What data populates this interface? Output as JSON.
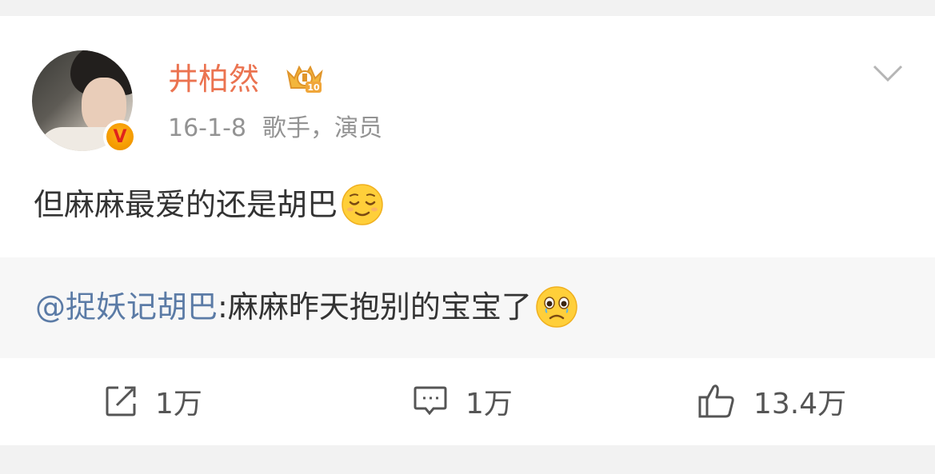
{
  "post": {
    "username": "井柏然",
    "date": "16-1-8",
    "source": "歌手，演员",
    "text": "但麻麻最爱的还是胡巴",
    "text_emoji": "relieved-face-icon",
    "verified_icon": "v-verified-icon",
    "level_icon": "crown-level-10-icon",
    "level_badge_text": "10"
  },
  "repost": {
    "mention": "@捉妖记胡巴",
    "text": ":麻麻昨天抱别的宝宝了",
    "emoji": "crying-face-icon"
  },
  "actions": {
    "repost": {
      "icon": "edit-share-icon",
      "count": "1万"
    },
    "comment": {
      "icon": "comment-icon",
      "count": "1万"
    },
    "like": {
      "icon": "thumbs-up-icon",
      "count": "13.4万"
    }
  },
  "colors": {
    "username": "#eb7350",
    "mention": "#5b7ba6",
    "meta": "#939393",
    "text": "#333333",
    "repost_bg": "#f7f7f7"
  }
}
